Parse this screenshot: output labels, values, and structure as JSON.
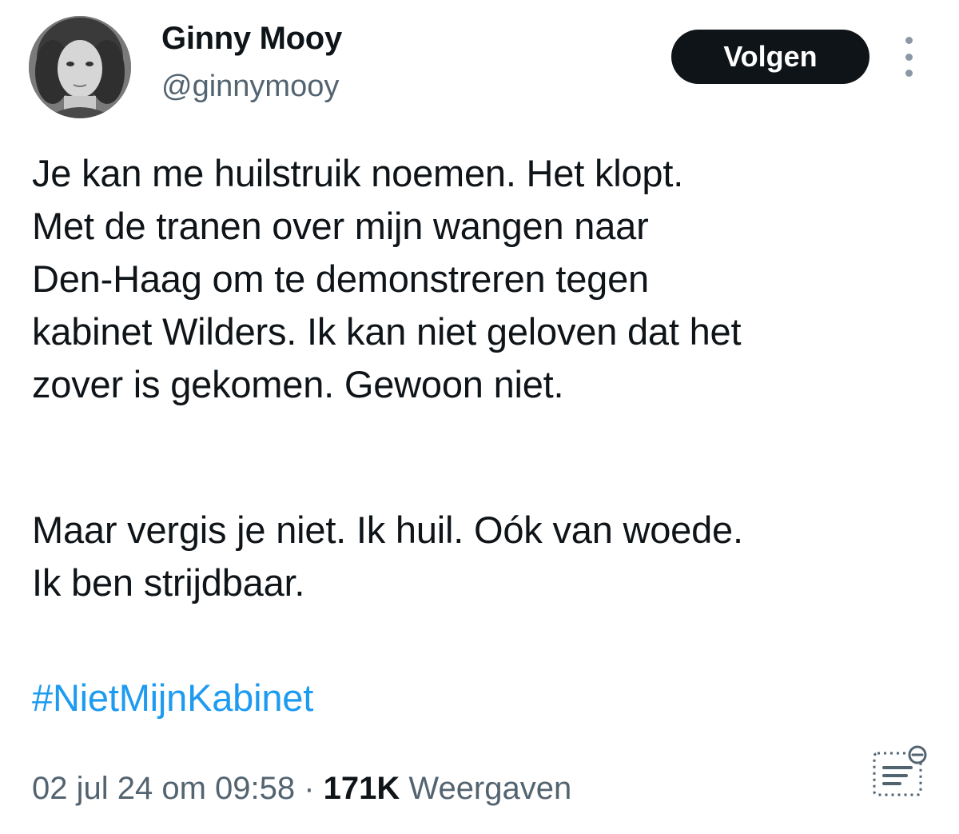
{
  "author": {
    "name": "Ginny Mooy",
    "handle": "@ginnymooy"
  },
  "actions": {
    "follow_label": "Volgen",
    "more_icon": "more-vertical-icon"
  },
  "tweet": {
    "paragraph1": "Je kan me huilstruik noemen. Het klopt.\nMet de tranen over mijn wangen naar\nDen-Haag om te demonstreren tegen\nkabinet Wilders. Ik kan niet geloven dat het\nzover is gekomen. Gewoon niet.",
    "paragraph2": "Maar vergis je niet. Ik huil. Oók van woede.\nIk ben strijdbaar.",
    "hashtag": "#NietMijnKabinet"
  },
  "meta": {
    "timestamp": "02 jul 24 om 09:58",
    "separator": " · ",
    "views_count": "171K",
    "views_label": " Weergaven"
  },
  "colors": {
    "text": "#0f1419",
    "secondary": "#536471",
    "link": "#1d9bf0",
    "button_bg": "#0f1419"
  }
}
